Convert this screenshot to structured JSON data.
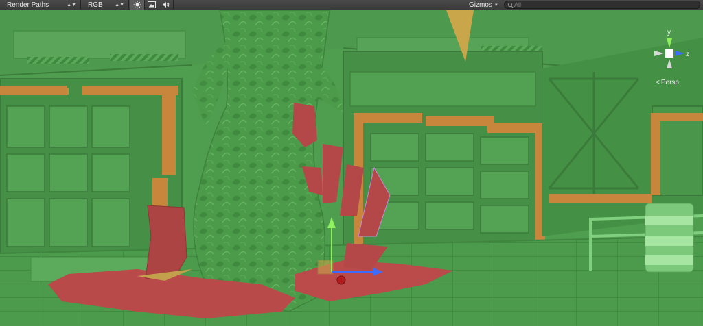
{
  "toolbar": {
    "render_mode": "Render Paths",
    "color_channel": "RGB",
    "gizmos_label": "Gizmos",
    "search": {
      "placeholder": "All"
    }
  },
  "viewport": {
    "projection_label": "Persp",
    "axis_labels": {
      "y": "y",
      "z": "z"
    },
    "overlay_colors": {
      "scene_tint": "#4f9d4f",
      "highlight": "#b84a4a"
    }
  },
  "icons": {
    "scene_lighting": "sun-icon",
    "scene_image": "image-icon",
    "scene_audio": "speaker-icon",
    "search": "search-icon"
  }
}
